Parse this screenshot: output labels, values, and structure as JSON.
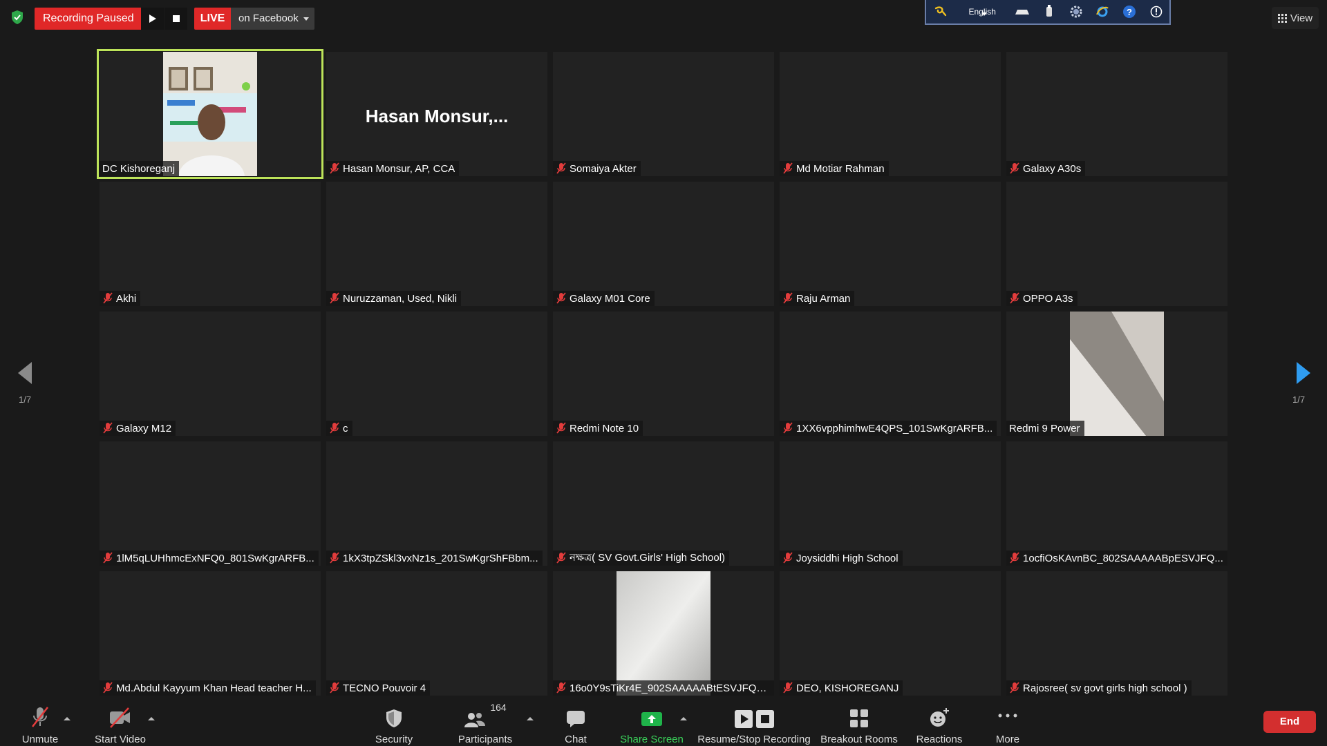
{
  "top_bar": {
    "recording_status": "Recording Paused",
    "live_badge": "LIVE",
    "live_destination": "on Facebook",
    "language": "English",
    "view_label": "View"
  },
  "grid": {
    "tiles": [
      {
        "name": "DC Kishoreganj",
        "muted": false,
        "video": true,
        "active": true
      },
      {
        "name": "Hasan Monsur, AP, CCA",
        "muted": true,
        "video": false,
        "big_name": "Hasan  Monsur,..."
      },
      {
        "name": "Somaiya Akter",
        "muted": true,
        "video": false
      },
      {
        "name": "Md Motiar Rahman",
        "muted": true,
        "video": false
      },
      {
        "name": "Galaxy A30s",
        "muted": true,
        "video": false
      },
      {
        "name": "Akhi",
        "muted": true,
        "video": false
      },
      {
        "name": "Nuruzzaman, Used, Nikli",
        "muted": true,
        "video": false
      },
      {
        "name": "Galaxy M01 Core",
        "muted": true,
        "video": false
      },
      {
        "name": "Raju Arman",
        "muted": true,
        "video": false
      },
      {
        "name": "OPPO A3s",
        "muted": true,
        "video": false
      },
      {
        "name": "Galaxy M12",
        "muted": true,
        "video": false
      },
      {
        "name": "c",
        "muted": true,
        "video": false
      },
      {
        "name": "Redmi Note 10",
        "muted": true,
        "video": false
      },
      {
        "name": "1XX6vpphimhwE4QPS_101SwKgrARFB...",
        "muted": true,
        "video": false
      },
      {
        "name": "Redmi 9 Power",
        "muted": false,
        "video": true
      },
      {
        "name": "1lM5qLUHhmcExNFQ0_801SwKgrARFB...",
        "muted": true,
        "video": false
      },
      {
        "name": "1kX3tpZSkl3vxNz1s_201SwKgrShFBbm...",
        "muted": true,
        "video": false
      },
      {
        "name": "নক্ষত্র( SV Govt.Girls' High School)",
        "muted": true,
        "video": false
      },
      {
        "name": "Joysiddhi High School",
        "muted": true,
        "video": false
      },
      {
        "name": "1ocfiOsKAvnBC_802SAAAAABpESVJFQ...",
        "muted": true,
        "video": false
      },
      {
        "name": "Md.Abdul Kayyum Khan Head teacher H...",
        "muted": true,
        "video": false
      },
      {
        "name": "TECNO Pouvoir 4",
        "muted": true,
        "video": false
      },
      {
        "name": "16o0Y9sTiKr4E_902SAAAAABtESVJFQ1...",
        "muted": true,
        "video": true
      },
      {
        "name": "DEO, KISHOREGANJ",
        "muted": true,
        "video": false
      },
      {
        "name": "Rajosree( sv govt girls high school )",
        "muted": true,
        "video": false
      }
    ]
  },
  "pagination": {
    "left": "1/7",
    "right": "1/7"
  },
  "toolbar": {
    "unmute": "Unmute",
    "start_video": "Start Video",
    "security": "Security",
    "participants": "Participants",
    "participant_count": "164",
    "chat": "Chat",
    "share_screen": "Share Screen",
    "recording": "Resume/Stop Recording",
    "breakout": "Breakout Rooms",
    "reactions": "Reactions",
    "more": "More",
    "end": "End"
  },
  "colors": {
    "accent_red": "#e02828",
    "active_speaker": "#bde35a",
    "share_green": "#3ad25a",
    "arrow_blue": "#2f9cf0"
  }
}
